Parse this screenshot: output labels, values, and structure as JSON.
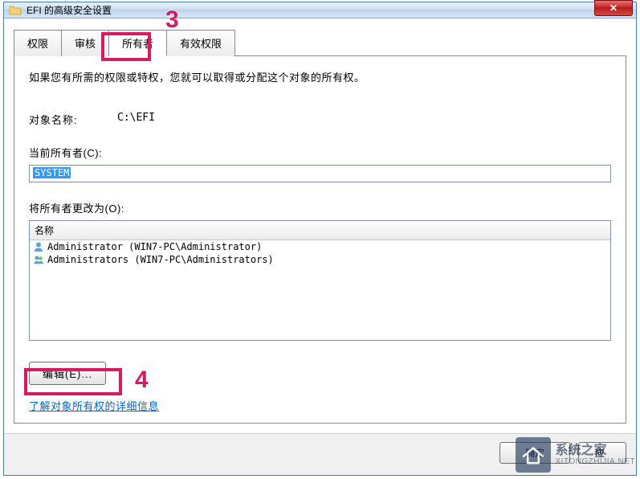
{
  "window": {
    "title": "EFI 的高级安全设置",
    "close_glyph": "✕"
  },
  "tabs": {
    "items": [
      {
        "label": "权限"
      },
      {
        "label": "审核"
      },
      {
        "label": "所有者"
      },
      {
        "label": "有效权限"
      }
    ],
    "active_index": 2
  },
  "content": {
    "description": "如果您有所需的权限或特权，您就可以取得或分配这个对象的所有权。",
    "object_label": "对象名称:",
    "object_value": "C:\\EFI",
    "current_owner_label": "当前所有者(C):",
    "current_owner_value": "SYSTEM",
    "change_owner_label": "将所有者更改为(O):",
    "list_header": "名称",
    "owners": [
      {
        "display": "Administrator (WIN7-PC\\Administrator)",
        "icon": "user-icon"
      },
      {
        "display": "Administrators (WIN7-PC\\Administrators)",
        "icon": "group-icon"
      }
    ],
    "edit_button": "编辑(E)...",
    "learn_more_link": "了解对象所有权的详细信息"
  },
  "footer": {
    "ok": "确定",
    "apply_partial": "应"
  },
  "annotations": {
    "n3": "3",
    "n4": "4",
    "color": "#d81b60"
  },
  "watermark": {
    "line1": "系统之家",
    "line2": "XITONGZHIJIA.NET"
  }
}
